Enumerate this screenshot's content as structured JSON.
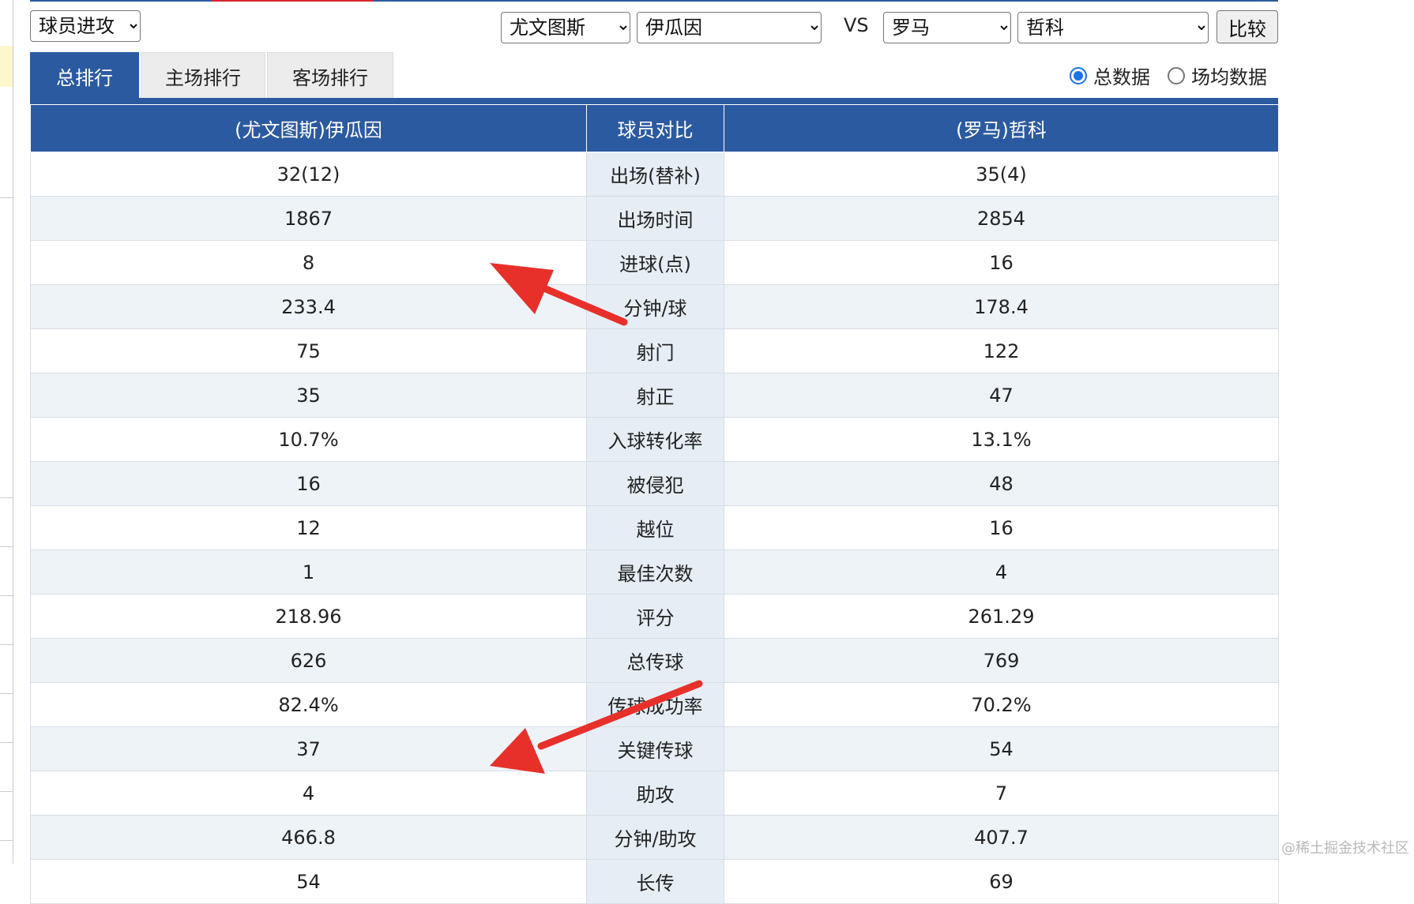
{
  "toolbar": {
    "category_select": "球员进攻",
    "team_a_select": "尤文图斯",
    "player_a_select": "伊瓜因",
    "vs_label": "VS",
    "team_b_select": "罗马",
    "player_b_select": "哲科",
    "compare_label": "比较"
  },
  "tabs": [
    {
      "label": "总排行",
      "active": true
    },
    {
      "label": "主场排行",
      "active": false
    },
    {
      "label": "客场排行",
      "active": false
    }
  ],
  "radios": [
    {
      "label": "总数据",
      "checked": true
    },
    {
      "label": "场均数据",
      "checked": false
    }
  ],
  "table": {
    "headers": [
      "(尤文图斯)伊瓜因",
      "球员对比",
      "(罗马)哲科"
    ],
    "rows": [
      {
        "left": "32(12)",
        "metric": "出场(替补)",
        "right": "35(4)"
      },
      {
        "left": "1867",
        "metric": "出场时间",
        "right": "2854"
      },
      {
        "left": "8",
        "metric": "进球(点)",
        "right": "16"
      },
      {
        "left": "233.4",
        "metric": "分钟/球",
        "right": "178.4"
      },
      {
        "left": "75",
        "metric": "射门",
        "right": "122"
      },
      {
        "left": "35",
        "metric": "射正",
        "right": "47"
      },
      {
        "left": "10.7%",
        "metric": "入球转化率",
        "right": "13.1%"
      },
      {
        "left": "16",
        "metric": "被侵犯",
        "right": "48"
      },
      {
        "left": "12",
        "metric": "越位",
        "right": "16"
      },
      {
        "left": "1",
        "metric": "最佳次数",
        "right": "4"
      },
      {
        "left": "218.96",
        "metric": "评分",
        "right": "261.29"
      },
      {
        "left": "626",
        "metric": "总传球",
        "right": "769"
      },
      {
        "left": "82.4%",
        "metric": "传球成功率",
        "right": "70.2%"
      },
      {
        "left": "37",
        "metric": "关键传球",
        "right": "54"
      },
      {
        "left": "4",
        "metric": "助攻",
        "right": "7"
      },
      {
        "left": "466.8",
        "metric": "分钟/助攻",
        "right": "407.7"
      },
      {
        "left": "54",
        "metric": "长传",
        "right": "69"
      }
    ]
  },
  "watermark": "@稀土掘金技术社区",
  "colors": {
    "header_blue": "#2c5aa0",
    "arrow_red": "#e8302a",
    "radio_blue": "#1a73e8"
  }
}
